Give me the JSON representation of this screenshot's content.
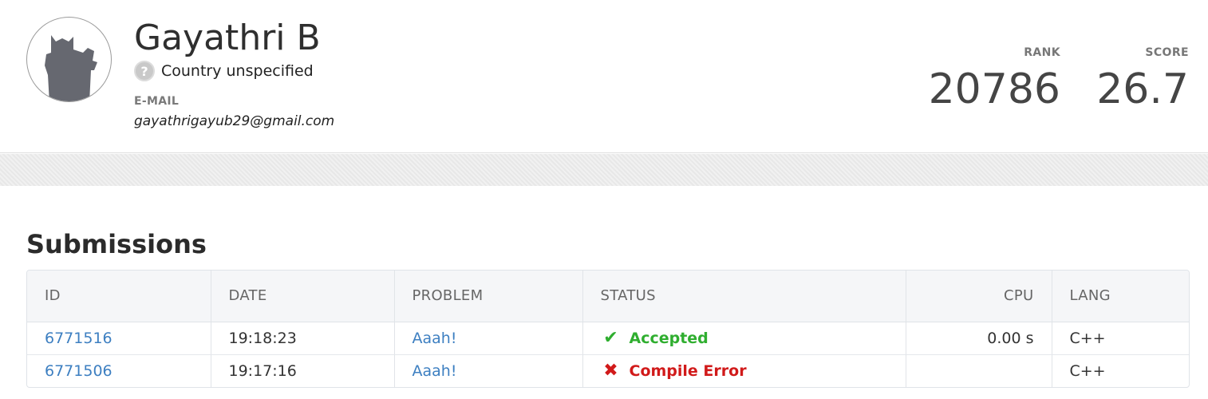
{
  "profile": {
    "name": "Gayathri B",
    "country_icon": "question-icon",
    "country": "Country unspecified",
    "email_label": "E-MAIL",
    "email": "gayathrigayub29@gmail.com",
    "avatar": "default-avatar-icon"
  },
  "stats": {
    "rank_label": "RANK",
    "rank_value": "20786",
    "score_label": "SCORE",
    "score_value": "26.7"
  },
  "submissions": {
    "title": "Submissions",
    "columns": {
      "id": "ID",
      "date": "DATE",
      "problem": "PROBLEM",
      "status": "STATUS",
      "cpu": "CPU",
      "lang": "LANG"
    },
    "rows": [
      {
        "id": "6771516",
        "date": "19:18:23",
        "problem": "Aaah!",
        "status": "Accepted",
        "status_icon": "check-icon",
        "status_color": "#2fae2f",
        "cpu": "0.00 s",
        "lang": "C++"
      },
      {
        "id": "6771506",
        "date": "19:17:16",
        "problem": "Aaah!",
        "status": "Compile Error",
        "status_icon": "cross-icon",
        "status_color": "#d11a1a",
        "cpu": "",
        "lang": "C++"
      }
    ]
  },
  "colors": {
    "link": "#3d7fc1",
    "accepted": "#2fae2f",
    "error": "#d11a1a"
  }
}
